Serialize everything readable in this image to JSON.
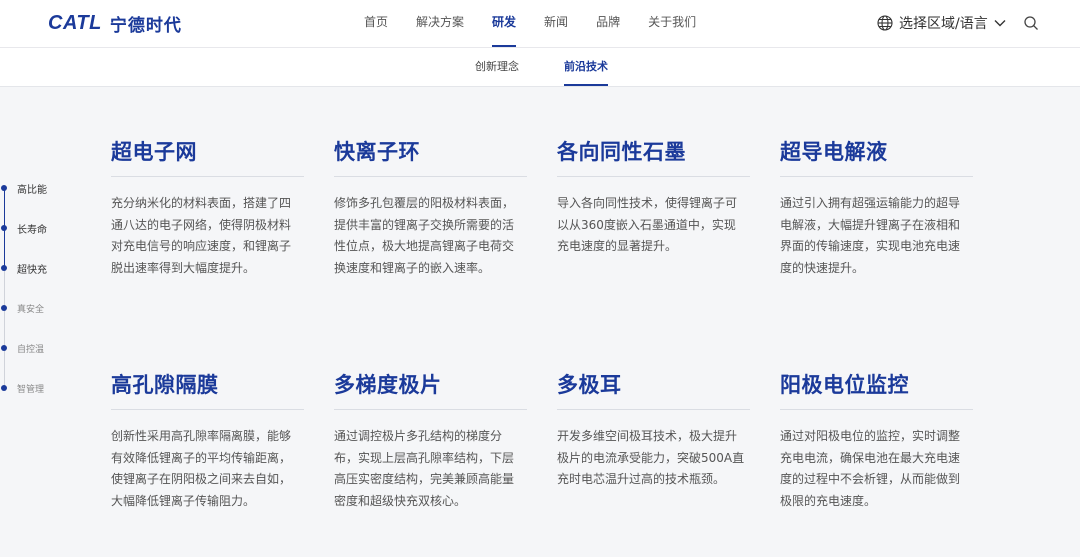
{
  "header": {
    "logo_en": "CATL",
    "logo_cn": "宁德时代",
    "nav": [
      "首页",
      "解决方案",
      "研发",
      "新闻",
      "品牌",
      "关于我们"
    ],
    "active_nav": "研发",
    "region_label": "选择区域/语言",
    "icons": {
      "globe": "globe-icon",
      "chevron": "chevron-down-icon",
      "search": "search-icon"
    }
  },
  "subnav": {
    "items": [
      "创新理念",
      "前沿技术"
    ],
    "active": "前沿技术"
  },
  "sidebar": {
    "items": [
      "高比能",
      "长寿命",
      "超快充",
      "真安全",
      "自控温",
      "智管理"
    ]
  },
  "cards": [
    {
      "title": "超电子网",
      "text": [
        "充分纳米化的材料表面，搭建了四",
        "通八达的电子网络，使得阴极材料",
        "对充电信号的响应速度，和锂离子",
        "脱出速率得到大幅度提升。"
      ]
    },
    {
      "title": "快离子环",
      "text": [
        "修饰多孔包覆层的阳极材料表面，",
        "提供丰富的锂离子交换所需要的活",
        "性位点，极大地提高锂离子电荷交",
        "换速度和锂离子的嵌入速率。"
      ]
    },
    {
      "title": "各向同性石墨",
      "text": [
        "导入各向同性技术，使得锂离子可",
        "以从360度嵌入石墨通道中，实现",
        "充电速度的显著提升。"
      ]
    },
    {
      "title": "超导电解液",
      "text": [
        "通过引入拥有超强运输能力的超导",
        "电解液，大幅提升锂离子在液相和",
        "界面的传输速度，实现电池充电速",
        "度的快速提升。"
      ]
    },
    {
      "title": "高孔隙隔膜",
      "text": [
        "创新性采用高孔隙率隔离膜，能够",
        "有效降低锂离子的平均传输距离，",
        "使锂离子在阴阳极之间来去自如，",
        "大幅降低锂离子传输阻力。"
      ]
    },
    {
      "title": "多梯度极片",
      "text": [
        "通过调控极片多孔结构的梯度分",
        "布，实现上层高孔隙率结构，下层",
        "高压实密度结构，完美兼顾高能量",
        "密度和超级快充双核心。"
      ]
    },
    {
      "title": "多极耳",
      "text": [
        "开发多维空间极耳技术，极大提升",
        "极片的电流承受能力，突破500A直",
        "充时电芯温升过高的技术瓶颈。"
      ]
    },
    {
      "title": "阳极电位监控",
      "text": [
        "通过对阳极电位的监控，实时调整",
        "充电电流，确保电池在最大充电速",
        "度的过程中不会析锂，从而能做到",
        "极限的充电速度。"
      ]
    }
  ]
}
